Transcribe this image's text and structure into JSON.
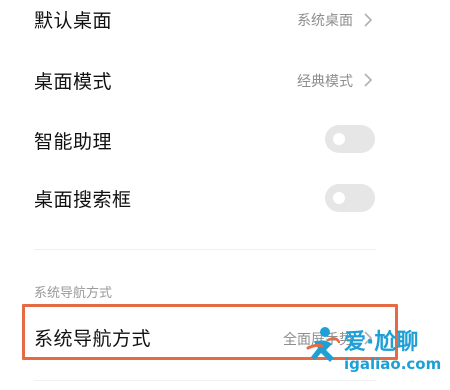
{
  "settings": {
    "default_desktop": {
      "label": "默认桌面",
      "value": "系统桌面"
    },
    "desktop_mode": {
      "label": "桌面模式",
      "value": "经典模式"
    },
    "smart_assistant": {
      "label": "智能助理",
      "enabled": false
    },
    "desktop_search": {
      "label": "桌面搜索框",
      "enabled": false
    }
  },
  "navigation_section": {
    "title": "系统导航方式",
    "row": {
      "label": "系统导航方式",
      "value": "全面屏手势"
    }
  },
  "watermark": {
    "text": "爱·尬聊",
    "url": "igaliao.com"
  },
  "colors": {
    "highlight_border": "#e46b43",
    "watermark": "#1e9fd6",
    "toggle_off": "#e6e6e6"
  }
}
